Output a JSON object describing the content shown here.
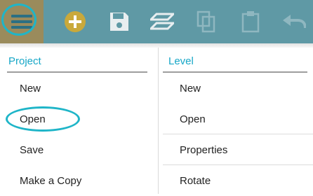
{
  "toolbar": {
    "icons": [
      "hamburger-menu-icon",
      "add-icon",
      "save-icon",
      "layers-icon",
      "copy-icon",
      "paste-icon",
      "undo-icon"
    ],
    "colors": {
      "bar": "#5f99a5",
      "menu_active": "#9a8b5c",
      "highlight": "#1fb5c8"
    }
  },
  "project": {
    "header": "Project",
    "items": [
      {
        "label": "New"
      },
      {
        "label": "Open"
      },
      {
        "label": "Save"
      },
      {
        "label": "Make a Copy"
      }
    ]
  },
  "level": {
    "header": "Level",
    "items": [
      {
        "label": "New"
      },
      {
        "label": "Open"
      },
      {
        "label": "Properties"
      },
      {
        "label": "Rotate"
      }
    ]
  }
}
